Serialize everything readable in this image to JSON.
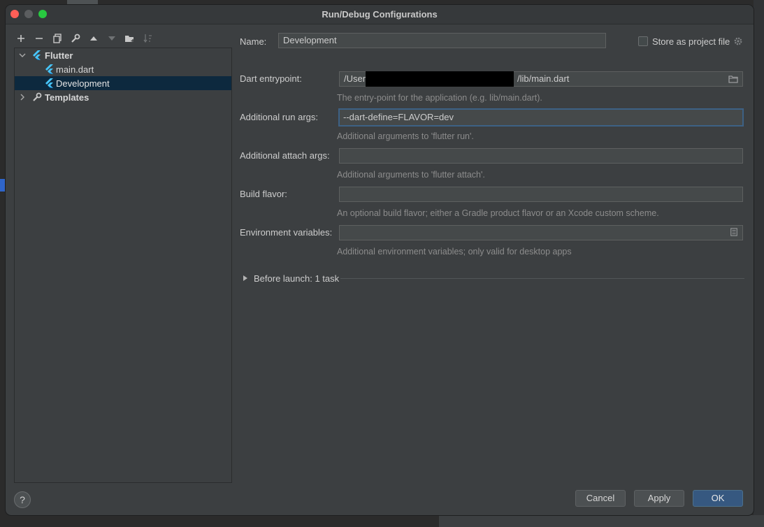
{
  "window": {
    "title": "Run/Debug Configurations"
  },
  "toolbar": {
    "icons": [
      "plus-icon",
      "minus-icon",
      "copy-icon",
      "wrench-icon",
      "arrow-up-icon",
      "arrow-down-icon",
      "folder-add-icon",
      "sort-icon"
    ]
  },
  "tree": {
    "flutter_label": "Flutter",
    "main_dart_label": "main.dart",
    "development_label": "Development",
    "templates_label": "Templates"
  },
  "form": {
    "name_label": "Name:",
    "name_value": "Development",
    "store_label": "Store as project file",
    "entrypoint_label": "Dart entrypoint:",
    "entrypoint_prefix": "/Users",
    "entrypoint_suffix": "/lib/main.dart",
    "entrypoint_hint": "The entry-point for the application (e.g. lib/main.dart).",
    "run_args_label": "Additional run args:",
    "run_args_value": "--dart-define=FLAVOR=dev",
    "run_args_hint": "Additional arguments to 'flutter run'.",
    "attach_args_label": "Additional attach args:",
    "attach_args_value": "",
    "attach_args_hint": "Additional arguments to 'flutter attach'.",
    "build_flavor_label": "Build flavor:",
    "build_flavor_value": "",
    "build_flavor_hint": "An optional build flavor; either a Gradle product flavor or an Xcode custom scheme.",
    "env_label": "Environment variables:",
    "env_value": "",
    "env_hint": "Additional environment variables; only valid for desktop apps",
    "before_launch_label": "Before launch: 1 task"
  },
  "buttons": {
    "help": "?",
    "cancel": "Cancel",
    "apply": "Apply",
    "ok": "OK"
  },
  "colors": {
    "accent": "#365880",
    "selection": "#0d293e",
    "flutter_blue": "#47c5fb"
  }
}
